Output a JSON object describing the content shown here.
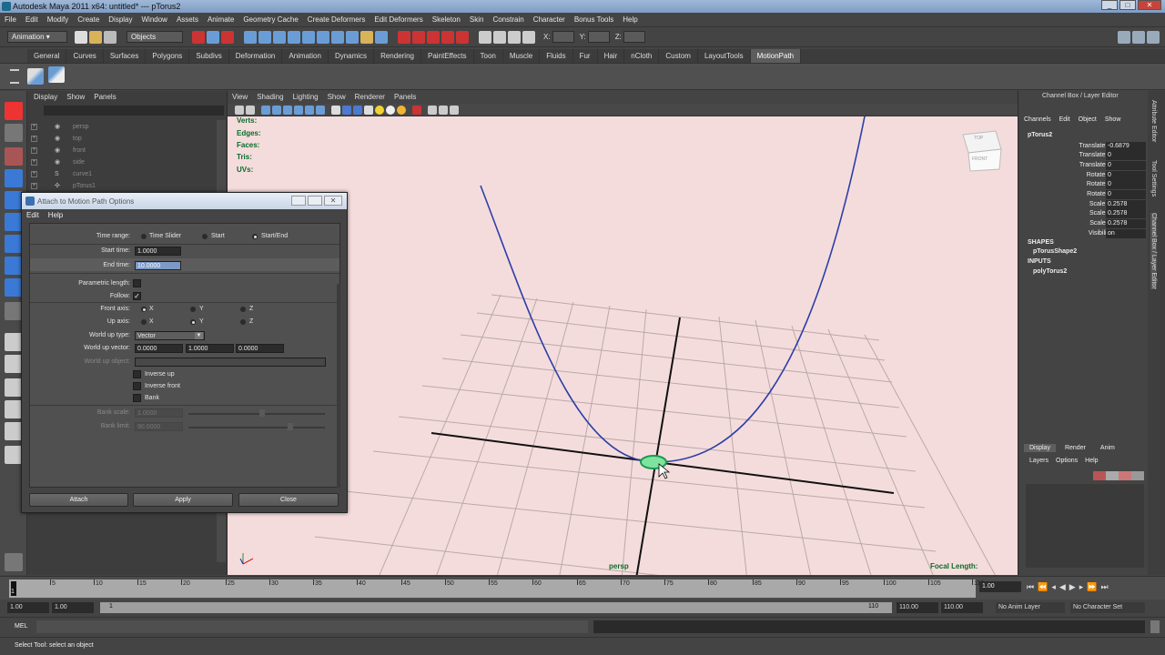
{
  "window": {
    "title": "Autodesk Maya 2011 x64: untitled*   ---   pTorus2",
    "minimize": "_",
    "maximize": "□",
    "close": "✕"
  },
  "menubar": [
    "File",
    "Edit",
    "Modify",
    "Create",
    "Display",
    "Window",
    "Assets",
    "Animate",
    "Geometry Cache",
    "Create Deformers",
    "Edit Deformers",
    "Skeleton",
    "Skin",
    "Constrain",
    "Character",
    "Bonus Tools",
    "Help"
  ],
  "status": {
    "menuset": "Animation",
    "selmode": "Objects",
    "x_label": "X:",
    "y_label": "Y:",
    "z_label": "Z:"
  },
  "shelf_tabs": [
    "General",
    "Curves",
    "Surfaces",
    "Polygons",
    "Subdivs",
    "Deformation",
    "Animation",
    "Dynamics",
    "Rendering",
    "PaintEffects",
    "Toon",
    "Muscle",
    "Fluids",
    "Fur",
    "Hair",
    "nCloth",
    "Custom",
    "LayoutTools",
    "MotionPath"
  ],
  "shelf_active": "MotionPath",
  "outliner": {
    "menu": [
      "Display",
      "Show",
      "Panels"
    ],
    "items": [
      "persp",
      "top",
      "front",
      "side",
      "curve1",
      "pTorus1"
    ]
  },
  "viewport": {
    "menu": [
      "View",
      "Shading",
      "Lighting",
      "Show",
      "Renderer",
      "Panels"
    ],
    "hud_labels": [
      "Verts:",
      "Edges:",
      "Faces:",
      "Tris:",
      "UVs:"
    ],
    "camera": "persp",
    "focal": "Focal Length:",
    "cube_top": "TOP",
    "cube_front": "FRONT"
  },
  "dialog": {
    "title": "Attach to Motion Path Options",
    "menu": [
      "Edit",
      "Help"
    ],
    "time_range_label": "Time range:",
    "time_range_options": [
      "Time Slider",
      "Start",
      "Start/End"
    ],
    "start_time_label": "Start time:",
    "start_time": "1.0000",
    "end_time_label": "End time:",
    "end_time": "10.0000",
    "param_length_label": "Parametric length:",
    "follow_label": "Follow:",
    "follow_check": "✓",
    "front_axis_label": "Front axis:",
    "up_axis_label": "Up axis:",
    "axis_x": "X",
    "axis_y": "Y",
    "axis_z": "Z",
    "world_up_type_label": "World up type:",
    "world_up_type": "Vector",
    "world_up_vector_label": "World up vector:",
    "world_up_vector": [
      "0.0000",
      "1.0000",
      "0.0000"
    ],
    "world_up_object_label": "World up object:",
    "inverse_up": "Inverse up",
    "inverse_front": "Inverse front",
    "bank": "Bank",
    "bank_scale_label": "Bank scale:",
    "bank_scale": "1.0000",
    "bank_limit_label": "Bank limit:",
    "bank_limit": "90.0000",
    "buttons": {
      "attach": "Attach",
      "apply": "Apply",
      "close": "Close"
    }
  },
  "channelbox": {
    "title": "Channel Box / Layer Editor",
    "menu": [
      "Channels",
      "Edit",
      "Object",
      "Show"
    ],
    "object": "pTorus2",
    "attrs": [
      {
        "name": "Translate X",
        "value": "-0.6879"
      },
      {
        "name": "Translate Y",
        "value": "0"
      },
      {
        "name": "Translate Z",
        "value": "0"
      },
      {
        "name": "Rotate X",
        "value": "0"
      },
      {
        "name": "Rotate Y",
        "value": "0"
      },
      {
        "name": "Rotate Z",
        "value": "0"
      },
      {
        "name": "Scale X",
        "value": "0.2578"
      },
      {
        "name": "Scale Y",
        "value": "0.2578"
      },
      {
        "name": "Scale Z",
        "value": "0.2578"
      },
      {
        "name": "Visibility",
        "value": "on"
      }
    ],
    "shapes_label": "SHAPES",
    "shape": "pTorusShape2",
    "inputs_label": "INPUTS",
    "input": "polyTorus2",
    "layer_tabs": [
      "Display",
      "Render",
      "Anim"
    ],
    "layer_menu": [
      "Layers",
      "Options",
      "Help"
    ]
  },
  "side_tabs": [
    "Attribute Editor",
    "Tool Settings",
    "Channel Box / Layer Editor"
  ],
  "timeline": {
    "ticks": [
      "5",
      "10",
      "15",
      "20",
      "25",
      "30",
      "35",
      "40",
      "45",
      "50",
      "55",
      "60",
      "65",
      "70",
      "75",
      "80",
      "85",
      "90",
      "95",
      "100",
      "105",
      "110"
    ],
    "current_frame": "1",
    "current_field": "1.00"
  },
  "range": {
    "start": "1.00",
    "playstart": "1.00",
    "slider_start": "1",
    "slider_end": "110",
    "playend": "110.00",
    "end": "110.00",
    "anim_layer": "No Anim Layer",
    "char_set": "No Character Set"
  },
  "cmd": {
    "label": "MEL"
  },
  "help": {
    "text": "Select Tool: select an object"
  }
}
